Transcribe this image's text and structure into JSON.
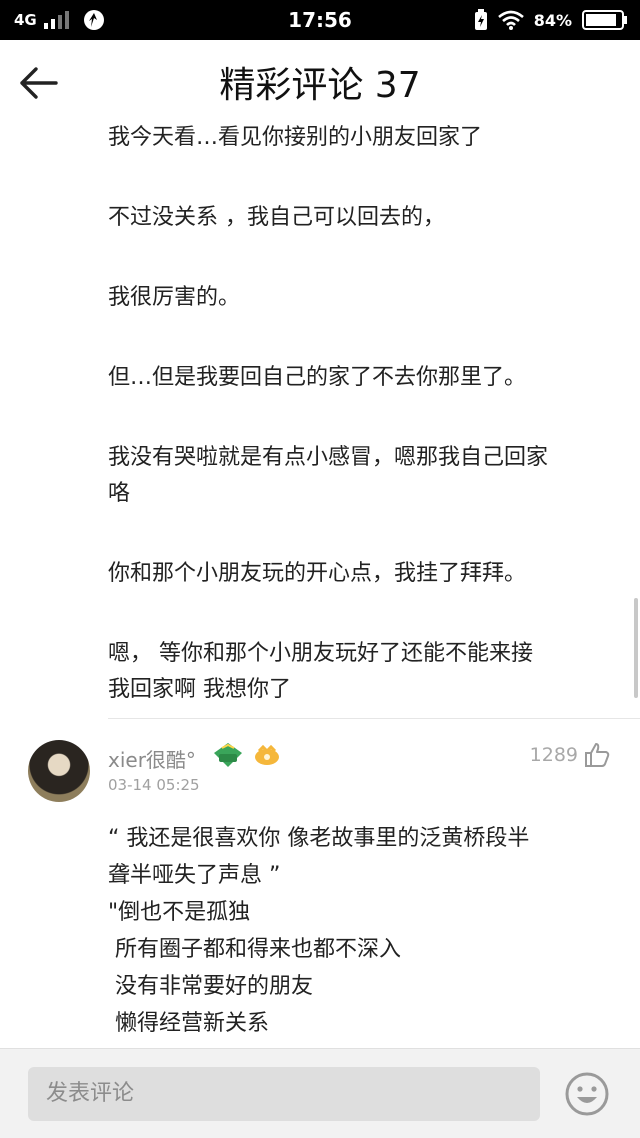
{
  "status_bar": {
    "network": "4G",
    "time": "17:56",
    "battery": "84%"
  },
  "header": {
    "title": "精彩评论 37"
  },
  "expanded_comment": {
    "paragraphs": [
      [
        "我今天看…看见你接别的小朋友回家了"
      ],
      [
        "不过没关系 ，我自己可以回去的，"
      ],
      [
        "我很厉害的。"
      ],
      [
        "但…但是我要回自己的家了不去你那里了。"
      ],
      [
        "我没有哭啦就是有点小感冒，嗯那我自己回家",
        "咯"
      ],
      [
        "你和那个小朋友玩的开心点，我挂了拜拜。"
      ],
      [
        "嗯， 等你和那个小朋友玩好了还能不能来接",
        "我回家啊 我想你了"
      ]
    ]
  },
  "comment": {
    "username": "xier很酷°",
    "timestamp": "03-14 05:25",
    "likes": "1289",
    "lines": [
      "“ 我还是很喜欢你 像老故事里的泛黄桥段半",
      "聋半哑失了声息 ”",
      "\"倒也不是孤独",
      " 所有圈子都和得来也都不深入",
      " 没有非常要好的朋友",
      " 懒得经营新关系"
    ]
  },
  "footer": {
    "input_placeholder": "发表评论"
  }
}
